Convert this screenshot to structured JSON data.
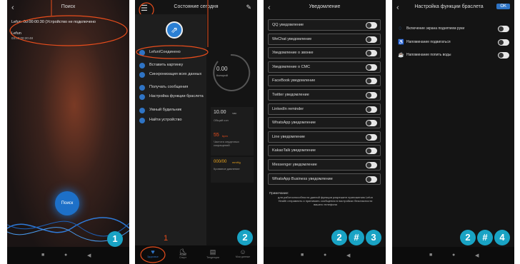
{
  "screens": {
    "search": {
      "title": "Поиск",
      "row_text": "Lefun :00:00:00:30 (Устройство не подключено",
      "device_name": "Lefun",
      "device_sub": "03:00:00:20:48",
      "search_button": "Поиск",
      "badge": "1"
    },
    "today": {
      "title": "Состояние сегодня",
      "annotation_menu": "2",
      "annotation_tab": "1",
      "menu_items": [
        "Lefun/Соединено",
        "Вставить картинку",
        "Синхронизация всех данных",
        "Получать сообщения",
        "Настройка функции браслета",
        "Умный будильник",
        "Найти устройство"
      ],
      "ring_value": "0.00",
      "ring_unit": "Калорий",
      "stats": [
        {
          "value": "10.00",
          "unit": "час",
          "label": "Общий сон"
        },
        {
          "value": "55",
          "unit": "bpm",
          "label": "Частота сердечных сокращений"
        },
        {
          "value": "000/00",
          "unit": "mmHg",
          "label": "Кровяное давление"
        }
      ],
      "tabs": [
        "Здоровье",
        "Спорт",
        "Тенденции",
        "Мои данные"
      ],
      "badge": "2"
    },
    "notifications": {
      "title": "Уведомление",
      "items": [
        "QQ уведомление",
        "WeChat уведомление",
        "Уведомление о звонке",
        "Уведомление о СМС",
        "FaceBook уведомление",
        "Twitter уведомление",
        "LinkedIn reminder",
        "WhatsApp уведомление",
        "Line уведомление",
        "KakaoTalk уведомление",
        "Messenger уведомление",
        "WhatsApp Business уведомление"
      ],
      "note_title": "Примечание:",
      "note_text": "для работоспособности данной функции разрешите приложению Lefun Health отправлять и принимать сообщения в настройках безопасности вашего телефона",
      "badges": [
        "2",
        "#",
        "3"
      ]
    },
    "bracelet": {
      "title": "Настройка функции браслета",
      "ok": "OK",
      "items": [
        "Включение экрана поднятием руки",
        "Напоминание подвигаться",
        "Напоминание попить воды"
      ],
      "badges": [
        "2",
        "#",
        "4"
      ]
    }
  },
  "colors": {
    "accent": "#19a3c4",
    "annotation": "#e84d1c",
    "toggle_blue": "#2f74c5"
  }
}
